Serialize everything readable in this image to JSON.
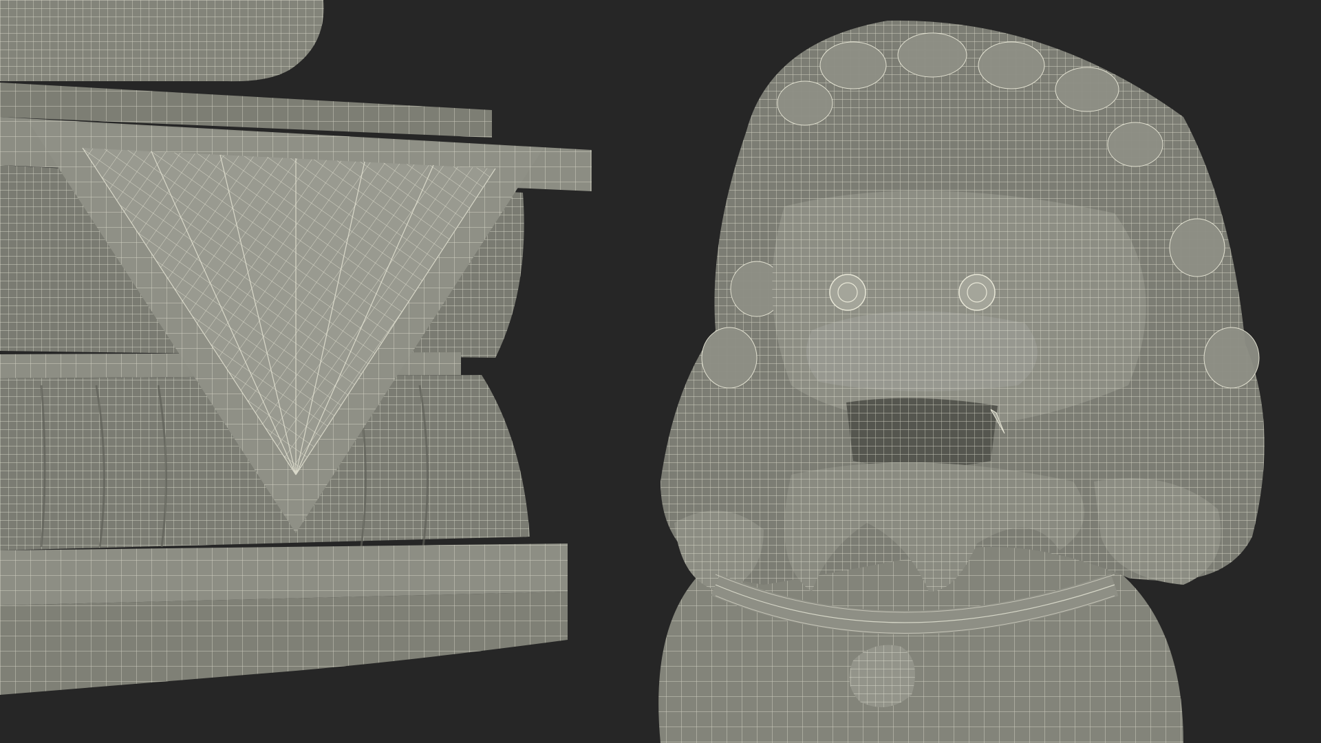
{
  "scene": {
    "background_color": "#262626",
    "surface_color": "#8a8b80",
    "surface_dark_color": "#6e6f66",
    "wire_color": "#e9e8d8",
    "left_object": "pedestal-base-icon",
    "right_object": "guardian-lion-head-icon"
  }
}
